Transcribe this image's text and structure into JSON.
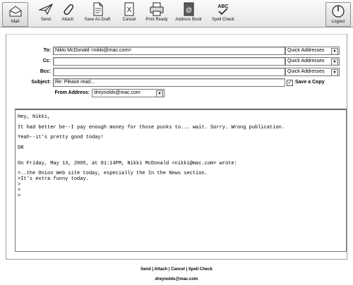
{
  "toolbar": {
    "mail": "Mail",
    "send": "Send",
    "attach": "Attach",
    "save_as_draft": "Save As Draft",
    "cancel": "Cancel",
    "print_ready": "Print Ready",
    "address_book": "Address Book",
    "spell_check": "Spell Check",
    "logout": "Logout"
  },
  "compose": {
    "to_label": "To:",
    "to_value": "Nikki McDonald <nikki@mac.com>",
    "cc_label": "Cc:",
    "cc_value": "",
    "bcc_label": "Bcc:",
    "bcc_value": "",
    "subject_label": "Subject:",
    "subject_value": "Re: Please read...",
    "quick_addresses": "Quick Addresses",
    "save_copy_label": "Save a Copy",
    "save_copy_checked": "✓",
    "from_label": "From Address:",
    "from_value": "dreynolds@mac.com"
  },
  "message_body": {
    "line1": "Hey, Nikki,",
    "line2": "It had better be--I pay enough money for those punks to... wait. Sorry. Wrong publication.",
    "line3": "Yeah--it's pretty good today!",
    "line4": "DR",
    "line5": "On Friday, May 13, 2005, at 01:14PM, Nikki McDonald <nikki@mac.com> wrote:",
    "line6": ">..the Onion Web site today, especially the In the News section.",
    "line7": ">It's extra funny today.",
    "line8": ">",
    "line9": ">",
    "line10": ">"
  },
  "footer": {
    "send": "Send",
    "attach": "Attach",
    "cancel": "Cancel",
    "spell_check": "Spell Check",
    "separator": " | ",
    "user": "dreynolds@mac.com"
  }
}
